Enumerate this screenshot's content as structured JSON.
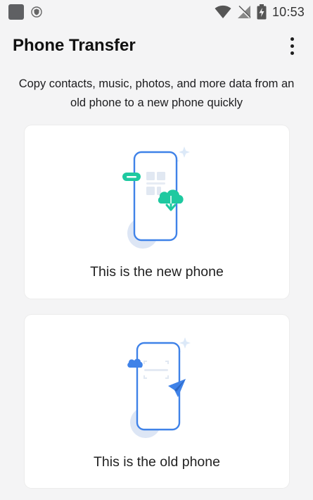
{
  "status_bar": {
    "time": "10:53"
  },
  "app_bar": {
    "title": "Phone Transfer"
  },
  "description": "Copy contacts, music, photos, and more data from an old phone to a new phone quickly",
  "options": [
    {
      "label": "This is the new phone",
      "icon": "new-phone-download-icon"
    },
    {
      "label": "This is the old phone",
      "icon": "old-phone-send-icon"
    }
  ],
  "colors": {
    "accent_blue": "#3f82e8",
    "accent_green": "#1ec9a0",
    "background": "#f4f4f5"
  }
}
